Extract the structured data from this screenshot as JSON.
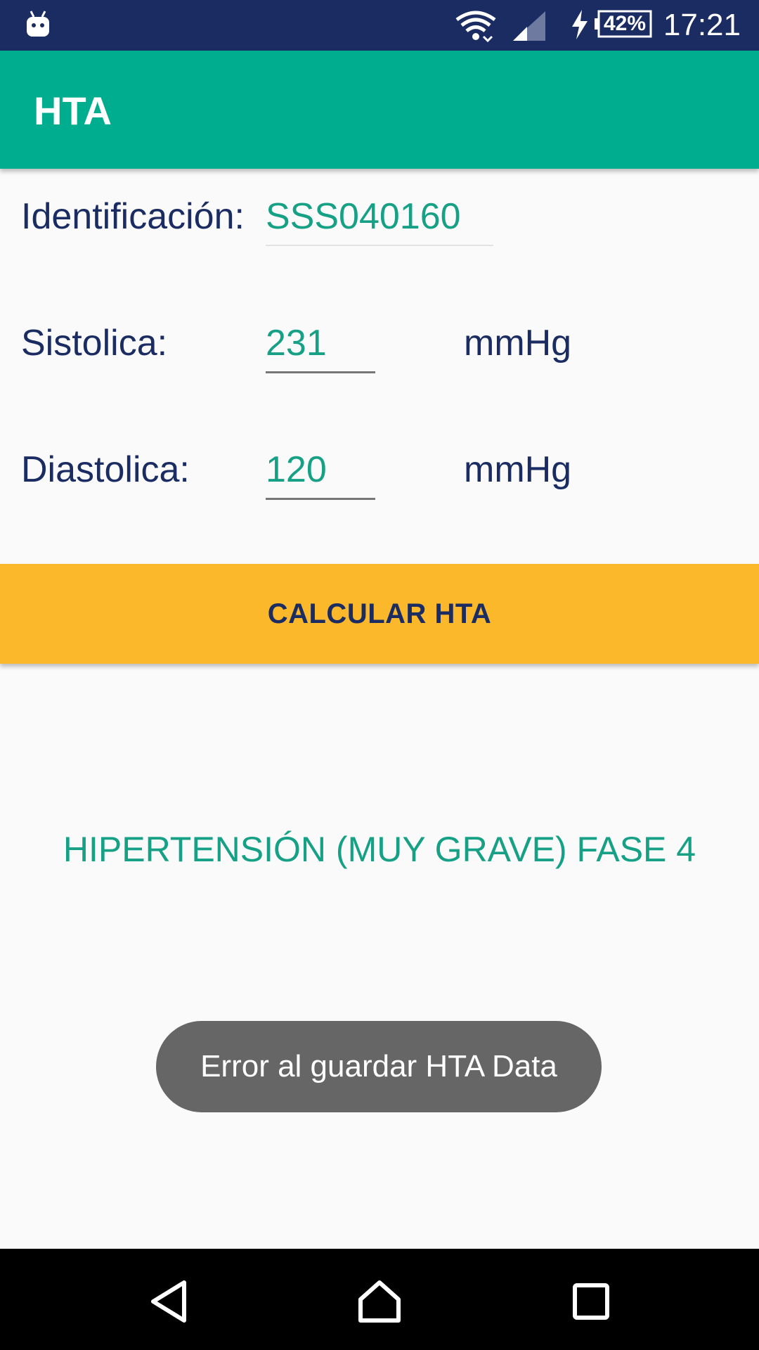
{
  "status_bar": {
    "time": "17:21",
    "battery": "42%",
    "icons": [
      "android-icon",
      "wifi-icon",
      "signal-icon",
      "charging-bolt-icon",
      "battery-icon"
    ]
  },
  "app_bar": {
    "title": "HTA"
  },
  "form": {
    "identificacion": {
      "label": "Identificación:",
      "value": "SSS040160"
    },
    "sistolica": {
      "label": "Sistolica:",
      "value": "231",
      "unit": "mmHg"
    },
    "diastolica": {
      "label": "Diastolica:",
      "value": "120",
      "unit": "mmHg"
    }
  },
  "calc_button": {
    "label": "CALCULAR HTA",
    "color": "#fbb82b"
  },
  "result": {
    "text": "HIPERTENSIÓN (MUY GRAVE) FASE 4"
  },
  "toast": {
    "text": "Error al guardar HTA Data"
  },
  "nav_bar": {
    "icons": [
      "back-icon",
      "home-icon",
      "recents-icon"
    ]
  },
  "colors": {
    "status_bar": "#1b2c63",
    "app_bar": "#00ad8e",
    "accent_text": "#16a085",
    "primary_text": "#1b2c63",
    "button": "#fbb82b"
  }
}
